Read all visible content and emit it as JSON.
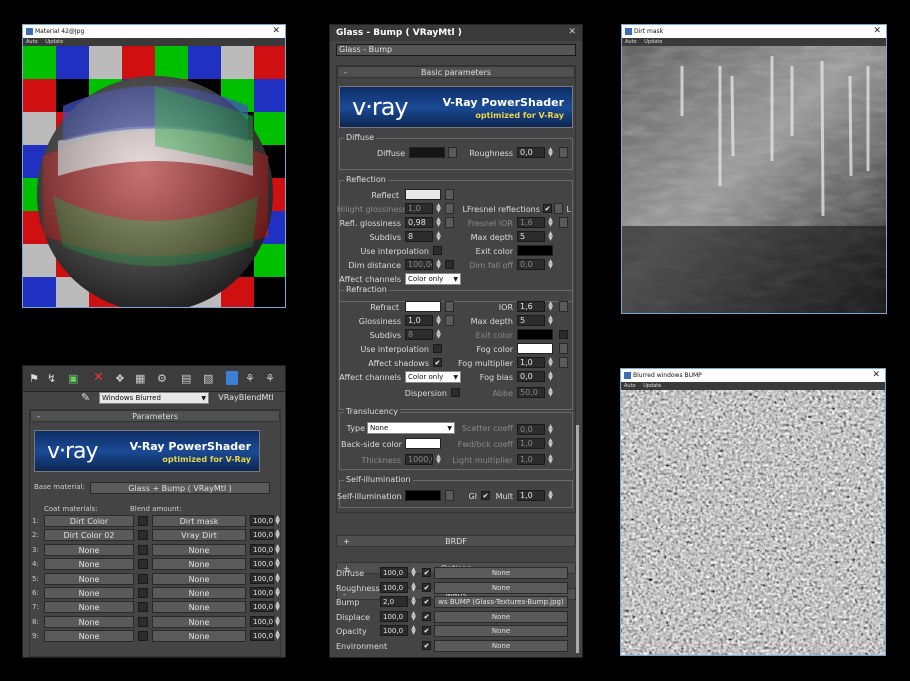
{
  "windows": {
    "material_preview": {
      "title": "Material 42@Jpg",
      "toolbar": [
        "Auto",
        "Update"
      ]
    },
    "dirt_mask": {
      "title": "Dirt mask",
      "toolbar": [
        "Auto",
        "Update"
      ]
    },
    "blurred_bump": {
      "title": "Blurred windows BUMP",
      "toolbar": [
        "Auto",
        "Update"
      ]
    }
  },
  "blend": {
    "material_name": "Windows Blurred",
    "material_type": "VRayBlendMtl",
    "rollout": "Parameters",
    "vray_banner": {
      "logo": "v·ray",
      "title": "V-Ray PowerShader",
      "subtitle": "optimized for V-Ray"
    },
    "base_label": "Base material:",
    "base_value": "Glass + Bump  ( VRayMtl )",
    "coat_header": "Coat materials:",
    "blend_header": "Blend amount:",
    "rows": [
      {
        "n": "1:",
        "coat": "Dirt Color",
        "blend": "Dirt mask",
        "amt": "100,0"
      },
      {
        "n": "2:",
        "coat": "Dirt Color 02",
        "blend": "Vray Dirt",
        "amt": "100,0"
      },
      {
        "n": "3:",
        "coat": "None",
        "blend": "None",
        "amt": "100,0"
      },
      {
        "n": "4:",
        "coat": "None",
        "blend": "None",
        "amt": "100,0"
      },
      {
        "n": "5:",
        "coat": "None",
        "blend": "None",
        "amt": "100,0"
      },
      {
        "n": "6:",
        "coat": "None",
        "blend": "None",
        "amt": "100,0"
      },
      {
        "n": "7:",
        "coat": "None",
        "blend": "None",
        "amt": "100,0"
      },
      {
        "n": "8:",
        "coat": "None",
        "blend": "None",
        "amt": "100,0"
      },
      {
        "n": "9:",
        "coat": "None",
        "blend": "None",
        "amt": "100,0"
      }
    ]
  },
  "glass": {
    "title": "Glass - Bump  ( VRayMtl )",
    "name": "Glass - Bump",
    "basic_rollout": "Basic parameters",
    "vray_banner": {
      "logo": "v·ray",
      "title": "V-Ray PowerShader",
      "subtitle": "optimized for V-Ray"
    },
    "diffuse_group": "Diffuse",
    "diffuse": "Diffuse",
    "roughness": "Roughness",
    "roughness_val": "0,0",
    "reflection_group": "Reflection",
    "reflect": "Reflect",
    "hilight": "Hilight glossiness",
    "hilight_val": "1,0",
    "fresnel": "Fresnel reflections",
    "refl_gloss": "Refl. glossiness",
    "refl_gloss_val": "0,98",
    "fresnel_ior": "Fresnel IOR",
    "fresnel_ior_val": "1,6",
    "subdivs": "Subdivs",
    "subdivs_val": "8",
    "max_depth": "Max depth",
    "max_depth_val": "5",
    "use_interp": "Use interpolation",
    "exit_color": "Exit color",
    "dim_distance": "Dim distance",
    "dim_distance_val": "100,0c",
    "dim_falloff": "Dim fall off",
    "dim_falloff_val": "0,0",
    "affect_channels": "Affect channels",
    "affect_val": "Color only",
    "L": "L",
    "refraction_group": "Refraction",
    "refract": "Refract",
    "ior": "IOR",
    "ior_val": "1,6",
    "glossiness": "Glossiness",
    "glossiness_val": "1,0",
    "r_max_depth_val": "5",
    "r_subdivs_val": "8",
    "fog_color": "Fog color",
    "affect_shadows": "Affect shadows",
    "fog_mult": "Fog multiplier",
    "fog_mult_val": "1,0",
    "fog_bias": "Fog bias",
    "fog_bias_val": "0,0",
    "dispersion": "Dispersion",
    "abbe": "Abbe",
    "abbe_val": "50,0",
    "translucency_group": "Translucency",
    "type": "Type",
    "type_val": "None",
    "scatter": "Scatter coeff",
    "scatter_val": "0,0",
    "backside": "Back-side color",
    "fwd": "Fwd/bck coeff",
    "fwd_val": "1,0",
    "thickness": "Thickness",
    "thickness_val": "1000,0",
    "light_mult": "Light multiplier",
    "light_mult_val": "1,0",
    "selfillum_group": "Self-illumination",
    "selfillum": "Self-illumination",
    "gi": "GI",
    "mult": "Mult",
    "mult_val": "1,0",
    "brdf": "BRDF",
    "options": "Options",
    "maps": "Maps",
    "map_rows": [
      {
        "name": "Diffuse",
        "amt": "100,0",
        "map": "None"
      },
      {
        "name": "Roughness",
        "amt": "100,0",
        "map": "None"
      },
      {
        "name": "Bump",
        "amt": "2,0",
        "map": "ws BUMP (Glass-Textures-Bump.jpg)"
      },
      {
        "name": "Displace",
        "amt": "100,0",
        "map": "None"
      },
      {
        "name": "Opacity",
        "amt": "100,0",
        "map": "None"
      },
      {
        "name": "Environment",
        "amt": "",
        "map": "None"
      }
    ]
  }
}
